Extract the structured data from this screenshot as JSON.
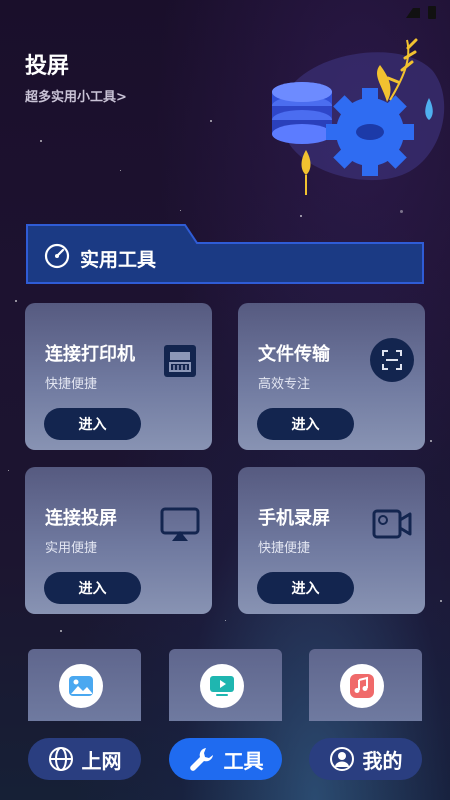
{
  "header": {
    "title": "投屏",
    "subtitle": "超多实用小工具>"
  },
  "section": {
    "title": "实用工具"
  },
  "cards": [
    {
      "title": "连接打印机",
      "subtitle": "快捷便捷",
      "button": "进入",
      "icon": "printer-icon"
    },
    {
      "title": "文件传输",
      "subtitle": "高效专注",
      "button": "进入",
      "icon": "scan-icon"
    },
    {
      "title": "连接投屏",
      "subtitle": "实用便捷",
      "button": "进入",
      "icon": "cast-icon"
    },
    {
      "title": "手机录屏",
      "subtitle": "快捷便捷",
      "button": "进入",
      "icon": "video-camera-icon"
    }
  ],
  "tiles": [
    {
      "icon": "image-icon",
      "color": "#4aa8f0"
    },
    {
      "icon": "tv-play-icon",
      "color": "#1fb6b0"
    },
    {
      "icon": "music-icon",
      "color": "#f06a6a"
    }
  ],
  "nav": [
    {
      "label": "上网",
      "icon": "globe-icon",
      "active": false
    },
    {
      "label": "工具",
      "icon": "wrench-icon",
      "active": true
    },
    {
      "label": "我的",
      "icon": "user-icon",
      "active": false
    }
  ],
  "colors": {
    "accent": "#1f6bf0",
    "banner": "#1b3a84",
    "button": "#13254f"
  }
}
